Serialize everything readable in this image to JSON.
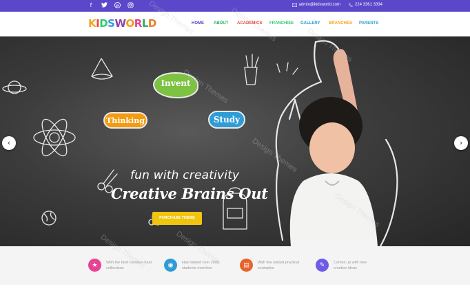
{
  "topbar": {
    "social_icons": [
      "facebook-icon",
      "twitter-icon",
      "pinterest-icon",
      "instagram-icon"
    ],
    "email": "admin@kidsworld.com",
    "phone": "224 3361 3334",
    "bg": "#5b47c9"
  },
  "header": {
    "logo_letters": [
      {
        "ch": "K",
        "color": "#f5a623"
      },
      {
        "ch": "I",
        "color": "#e74c3c"
      },
      {
        "ch": "D",
        "color": "#2ecc71"
      },
      {
        "ch": "S",
        "color": "#3498db"
      },
      {
        "ch": "W",
        "color": "#8e44ad"
      },
      {
        "ch": "O",
        "color": "#f39c12"
      },
      {
        "ch": "R",
        "color": "#e84393"
      },
      {
        "ch": "L",
        "color": "#27ae60"
      },
      {
        "ch": "D",
        "color": "#e67e22"
      }
    ],
    "nav": [
      {
        "label": "HOME",
        "color": "#5b47c9"
      },
      {
        "label": "ABOUT",
        "color": "#27ae60"
      },
      {
        "label": "ACADEMICS",
        "color": "#e74c3c"
      },
      {
        "label": "FRANCHISE",
        "color": "#2ecc71"
      },
      {
        "label": "GALLERY",
        "color": "#3498db"
      },
      {
        "label": "BRANCHES",
        "color": "#f5a623"
      },
      {
        "label": "PARENTS",
        "color": "#2f9cd6"
      }
    ]
  },
  "hero": {
    "bubbles": {
      "invent": "Invent",
      "thinking": "Thinking",
      "study": "Study"
    },
    "tagline": "fun with creativity",
    "headline": "Creative Brains Out",
    "cta": "PURCHASE THEME",
    "prev_icon": "chevron-left-icon",
    "next_icon": "chevron-right-icon"
  },
  "features": [
    {
      "icon": "star-icon",
      "color": "#e84393",
      "text": "With the best creative class collections"
    },
    {
      "icon": "eye-icon",
      "color": "#2f9cd6",
      "text": "Has trained over 2000 students overtime"
    },
    {
      "icon": "clipboard-icon",
      "color": "#e8632a",
      "text": "With live solved practical examples"
    },
    {
      "icon": "lightbulb-icon",
      "color": "#6c5ce7",
      "text": "Comes up with new creative ideas"
    }
  ],
  "watermark": "Design Themes"
}
